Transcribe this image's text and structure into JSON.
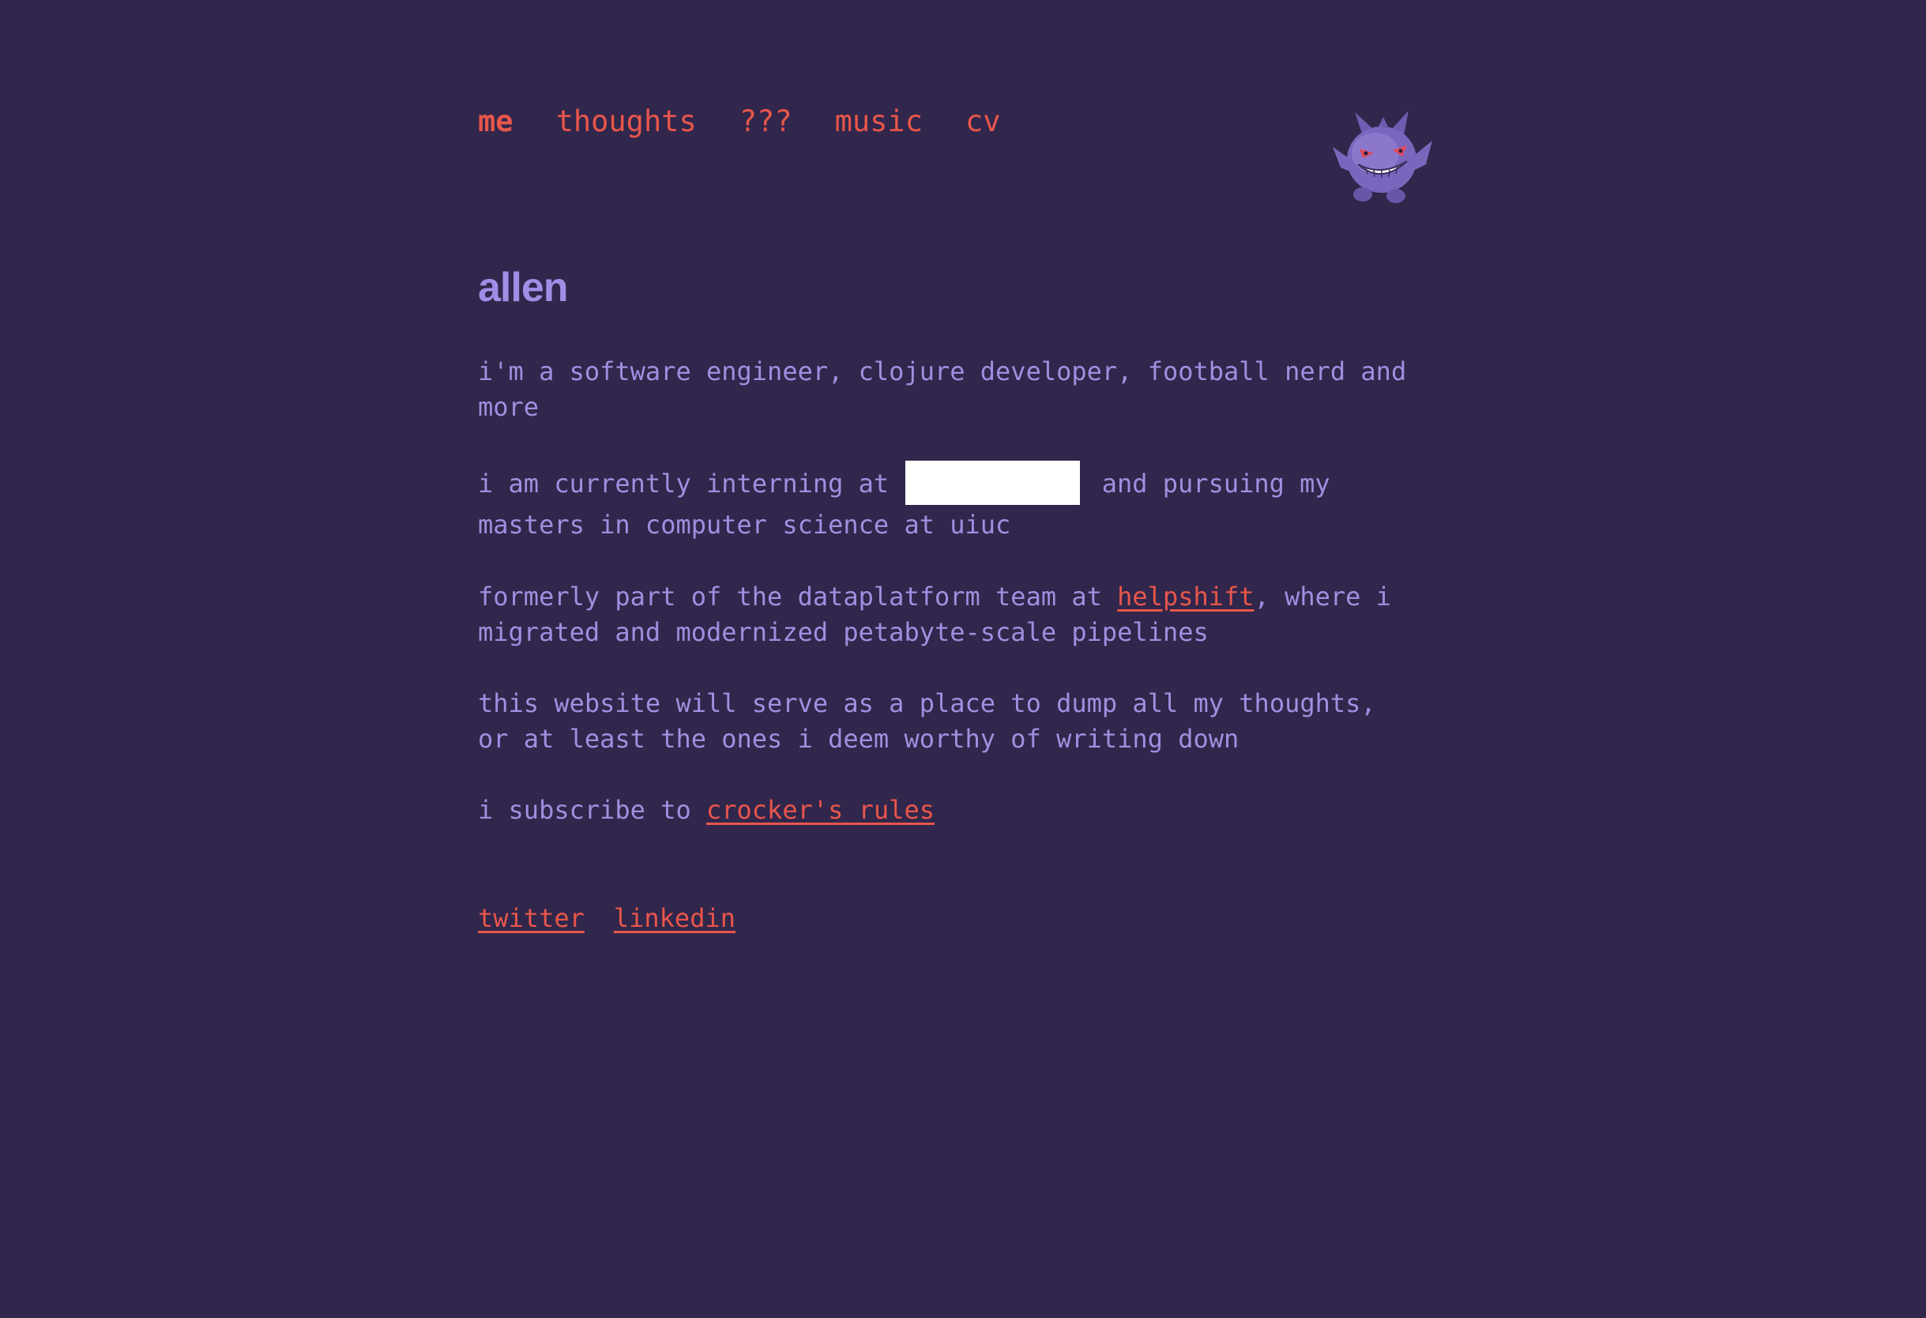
{
  "nav": {
    "items": [
      {
        "label": "me",
        "active": true
      },
      {
        "label": "thoughts",
        "active": false
      },
      {
        "label": "???",
        "active": false
      },
      {
        "label": "music",
        "active": false
      },
      {
        "label": "cv",
        "active": false
      }
    ]
  },
  "mascot": {
    "icon": "gengar-sprite-icon"
  },
  "profile": {
    "name": "allen"
  },
  "bio": {
    "p1": "i'm a software engineer, clojure developer, football nerd and more",
    "p2_before": "i am currently interning at",
    "p2_after": "and pursuing my masters in computer science at uiuc",
    "p3_before": "formerly part of the dataplatform team at ",
    "p3_link": "helpshift",
    "p3_after": ", where i migrated and modernized petabyte-scale pipelines",
    "p4": "this website will serve as a place to dump all my thoughts, or at least the ones i deem worthy of writing down",
    "p5_before": "i subscribe to ",
    "p5_link": "crocker's rules"
  },
  "socials": {
    "twitter": "twitter",
    "linkedin": "linkedin"
  },
  "colors": {
    "background": "#31264b",
    "text": "#a08fe0",
    "accent": "#e8564b"
  }
}
